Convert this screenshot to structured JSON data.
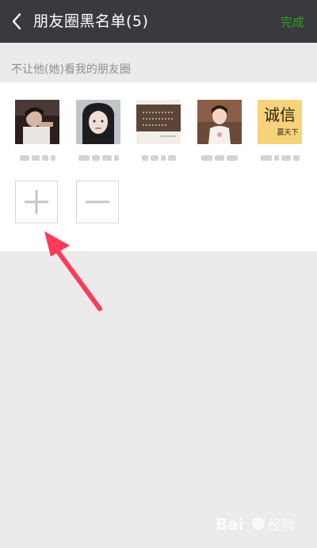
{
  "header": {
    "title": "朋友圈黑名单(5)",
    "done_label": "完成"
  },
  "section": {
    "label": "不让他(她)看我的朋友圈"
  },
  "members": [
    {
      "name": "",
      "icon": "photo-avatar"
    },
    {
      "name": "",
      "icon": "photo-avatar"
    },
    {
      "name": "",
      "icon": "quote-image-avatar"
    },
    {
      "name": "",
      "icon": "photo-avatar"
    },
    {
      "name": "",
      "icon": "calligraphy-avatar"
    }
  ],
  "member_avatar_text": {
    "calligraphy": "诚信",
    "calligraphy_small": "赢天下"
  },
  "actions": {
    "add_icon": "plus-icon",
    "remove_icon": "minus-icon"
  },
  "colors": {
    "topbar": "#393a3f",
    "accent_done": "#2aa515",
    "annotation_arrow": "#ff3b57",
    "background": "#ebebeb"
  },
  "watermark": {
    "brand": "Bai",
    "brand_suffix": "经验"
  }
}
